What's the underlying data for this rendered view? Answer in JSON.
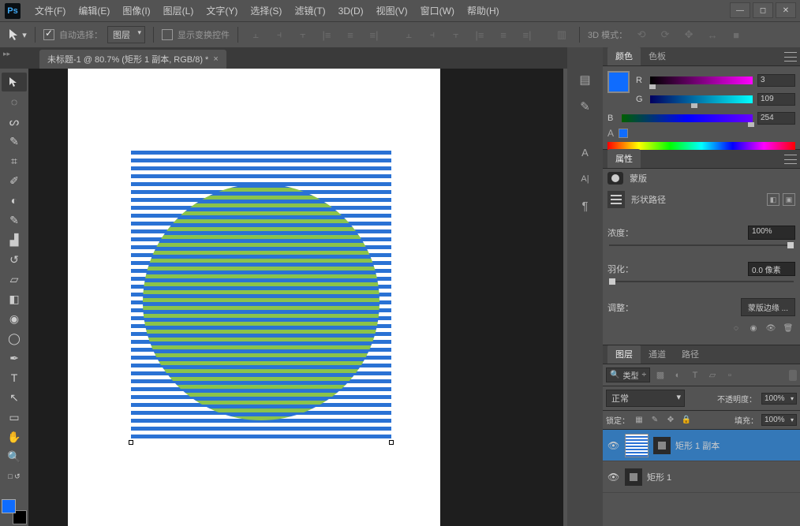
{
  "app": {
    "logo": "Ps"
  },
  "menu": [
    "文件(F)",
    "编辑(E)",
    "图像(I)",
    "图层(L)",
    "文字(Y)",
    "选择(S)",
    "滤镜(T)",
    "3D(D)",
    "视图(V)",
    "窗口(W)",
    "帮助(H)"
  ],
  "options": {
    "autoselect_label": "自动选择：",
    "target": "图层",
    "transform_label": "显示变换控件",
    "mode3d_label": "3D 模式："
  },
  "document": {
    "tab_title": "未标题-1 @ 80.7% (矩形 1 副本, RGB/8) *"
  },
  "color_panel": {
    "tabs": [
      "颜色",
      "色板"
    ],
    "r": "3",
    "g": "109",
    "b": "254"
  },
  "properties_panel": {
    "tab": "属性",
    "mask_label": "蒙版",
    "shape_path_label": "形状路径",
    "density_label": "浓度：",
    "density_val": "100%",
    "feather_label": "羽化：",
    "feather_val": "0.0 像素",
    "adjust_label": "调整：",
    "mask_edge_btn": "蒙版边缘 ..."
  },
  "layers_panel": {
    "tabs": [
      "图层",
      "通道",
      "路径"
    ],
    "filter_type": "类型",
    "blend_mode": "正常",
    "opacity_label": "不透明度：",
    "opacity_val": "100%",
    "lock_label": "锁定：",
    "fill_label": "填充：",
    "fill_val": "100%",
    "layers": [
      {
        "name": "矩形 1 副本",
        "selected": true
      },
      {
        "name": "矩形 1",
        "selected": false
      }
    ]
  }
}
